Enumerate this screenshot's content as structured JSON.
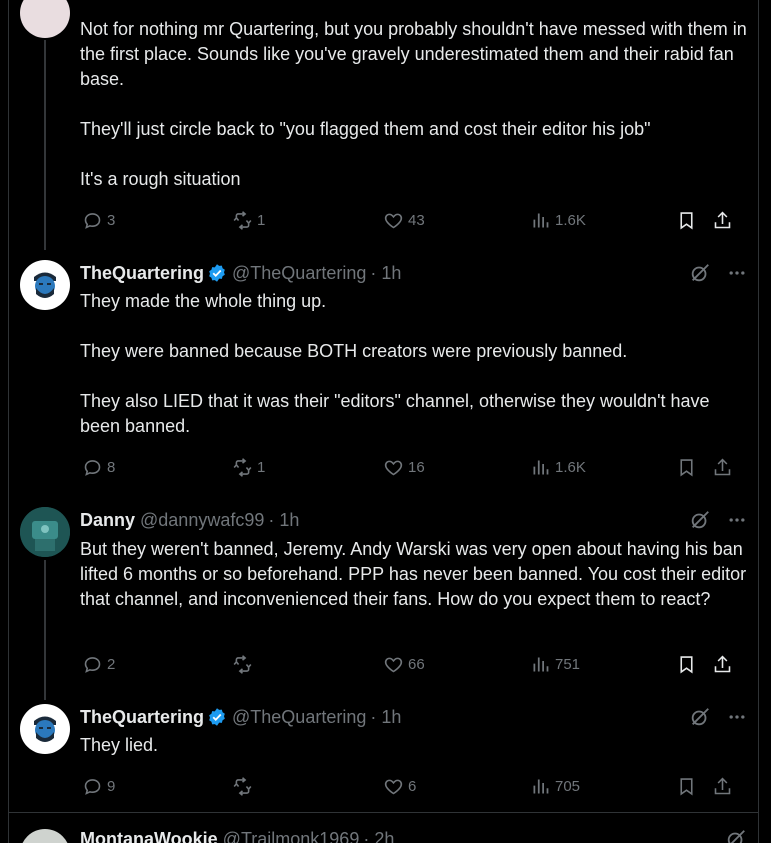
{
  "posts": [
    {
      "id": "p1",
      "paragraphs": [
        "Not for nothing mr Quartering, but you probably shouldn't have messed with them in the first place.    Sounds like you've gravely underestimated them and their rabid fan base.",
        "They'll just circle back to \"you flagged them and cost their editor his job\"",
        "It's a rough situation"
      ],
      "replies": "3",
      "reposts": "1",
      "likes": "43",
      "views": "1.6K"
    },
    {
      "id": "p2",
      "name": "TheQuartering",
      "handle": "@TheQuartering",
      "time": "· 1h",
      "paragraphs": [
        "They made the whole thing up.",
        "They were banned because BOTH creators were previously banned.",
        "They also LIED that it was their \"editors\" channel, otherwise they wouldn't have been banned."
      ],
      "replies": "8",
      "reposts": "1",
      "likes": "16",
      "views": "1.6K"
    },
    {
      "id": "p3",
      "name": "Danny",
      "handle": "@dannywafc99",
      "time": "· 1h",
      "paragraphs": [
        "But they weren't banned, Jeremy. Andy Warski was very open about having his ban lifted 6 months or so beforehand. PPP has never been banned. You cost their editor that channel, and inconvenienced their fans. How do you expect them to react?"
      ],
      "replies": "2",
      "reposts": "",
      "likes": "66",
      "views": "751"
    },
    {
      "id": "p4",
      "name": "TheQuartering",
      "handle": "@TheQuartering",
      "time": "· 1h",
      "paragraphs": [
        "They lied."
      ],
      "replies": "9",
      "reposts": "",
      "likes": "6",
      "views": "705"
    },
    {
      "id": "p5",
      "name": "MontanaWookie",
      "handle": "@Trailmonk1969",
      "time": "· 2h"
    }
  ],
  "icons": {
    "reply": "reply-icon",
    "repost": "repost-icon",
    "like": "heart-icon",
    "views": "views-icon",
    "bookmark": "bookmark-icon",
    "share": "share-icon",
    "grok": "grok-icon",
    "more": "more-icon",
    "verified": "verified-badge-icon"
  },
  "colors": {
    "background": "#000000",
    "text": "#e7e9ea",
    "muted": "#71767b",
    "verified": "#1d9bf0",
    "border": "#2f3336"
  }
}
